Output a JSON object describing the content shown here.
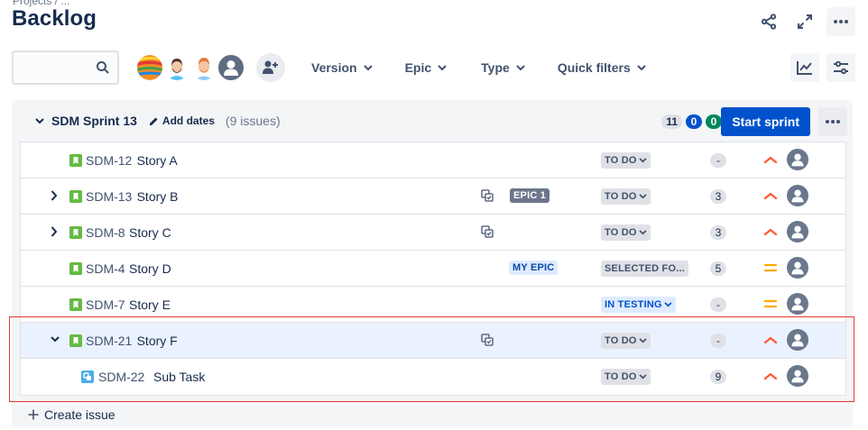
{
  "header": {
    "breadcrumb_fragment": "Projects / ...",
    "title": "Backlog"
  },
  "toolbar": {
    "search": {
      "value": "",
      "placeholder": ""
    },
    "filters": [
      {
        "label": "Version"
      },
      {
        "label": "Epic"
      },
      {
        "label": "Type"
      },
      {
        "label": "Quick filters"
      }
    ]
  },
  "sprint": {
    "name": "SDM Sprint 13",
    "add_dates": "Add dates",
    "issue_count": "(9 issues)",
    "counts": {
      "todo": "11",
      "in_progress": "0",
      "done": "0"
    },
    "start_button": "Start sprint",
    "issues": [
      {
        "key": "SDM-12",
        "summary": "Story A",
        "type": "story",
        "expander": "none",
        "subtasks": false,
        "epic": "",
        "status": "TO DO",
        "points": "-",
        "priority": "high"
      },
      {
        "key": "SDM-13",
        "summary": "Story B",
        "type": "story",
        "expander": "collapsed",
        "subtasks": true,
        "epic": "EPIC 1",
        "status": "TO DO",
        "points": "3",
        "priority": "high"
      },
      {
        "key": "SDM-8",
        "summary": "Story C",
        "type": "story",
        "expander": "collapsed",
        "subtasks": true,
        "epic": "",
        "status": "TO DO",
        "points": "3",
        "priority": "high"
      },
      {
        "key": "SDM-4",
        "summary": "Story D",
        "type": "story",
        "expander": "none",
        "subtasks": false,
        "epic": "MY EPIC",
        "status": "SELECTED FO...",
        "points": "5",
        "priority": "medium"
      },
      {
        "key": "SDM-7",
        "summary": "Story E",
        "type": "story",
        "expander": "none",
        "subtasks": false,
        "epic": "",
        "status": "IN TESTING",
        "points": "-",
        "priority": "medium"
      },
      {
        "key": "SDM-21",
        "summary": "Story F",
        "type": "story",
        "expander": "expanded",
        "subtasks": true,
        "epic": "",
        "status": "TO DO",
        "points": "-",
        "priority": "high"
      },
      {
        "key": "SDM-22",
        "summary": "Sub Task",
        "type": "subtask",
        "expander": "none",
        "subtasks": false,
        "epic": "",
        "status": "TO DO",
        "points": "9",
        "priority": "high"
      }
    ]
  },
  "create_issue": "Create issue",
  "colors": {
    "primary": "#0052cc",
    "story": "#65ba43",
    "subtask": "#4bade8",
    "priority_high": "#ff5630",
    "priority_medium": "#ffab00",
    "highlight": "#e53935",
    "selected_row": "#ebf2ff"
  }
}
